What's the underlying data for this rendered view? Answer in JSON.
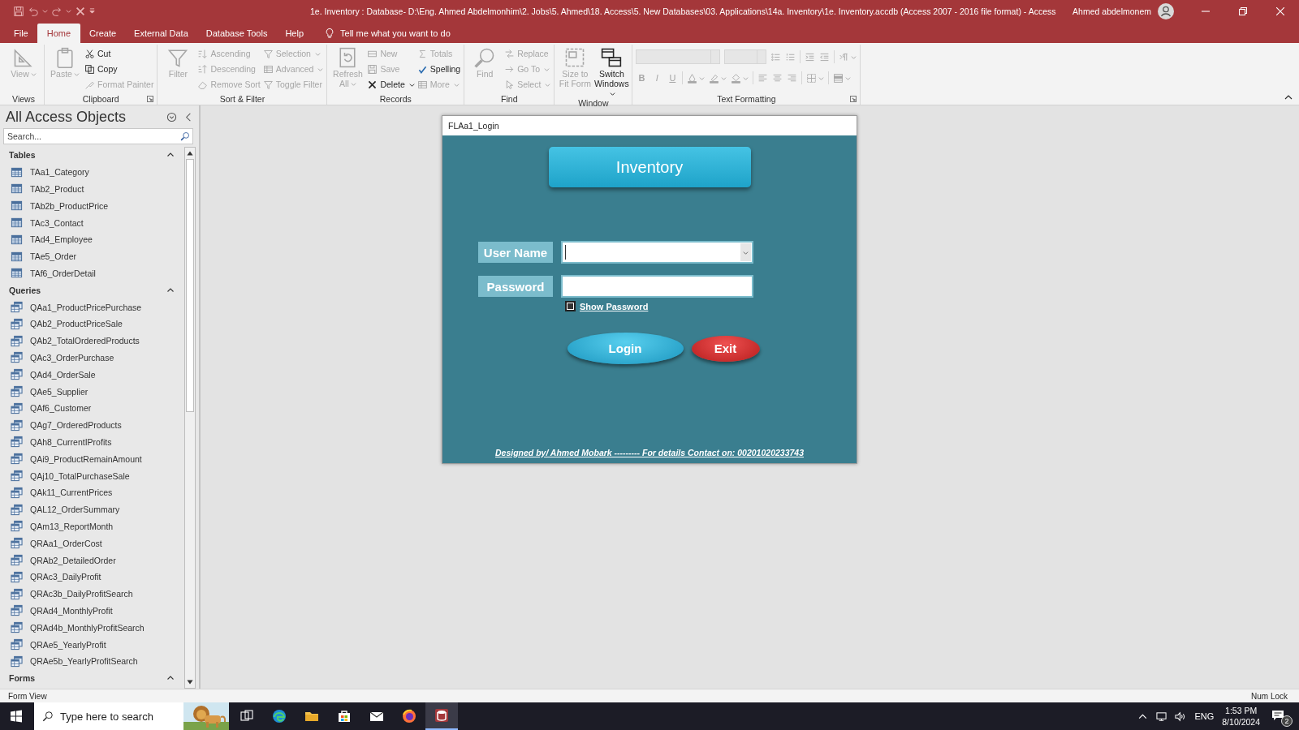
{
  "window": {
    "title": "1e. Inventory : Database- D:\\Eng. Ahmed Abdelmonhim\\2. Jobs\\5. Ahmed\\18. Access\\5. New Databases\\03. Applications\\14a. Inventory\\1e. Inventory.accdb (Access 2007 - 2016 file format)  -  Access",
    "user": "Ahmed abdelmonem"
  },
  "menu_tabs": [
    {
      "label": "File",
      "selected": false
    },
    {
      "label": "Home",
      "selected": true
    },
    {
      "label": "Create",
      "selected": false
    },
    {
      "label": "External Data",
      "selected": false
    },
    {
      "label": "Database Tools",
      "selected": false
    },
    {
      "label": "Help",
      "selected": false
    }
  ],
  "tell_me": "Tell me what you want to do",
  "ribbon": {
    "groups": [
      {
        "label": "Views",
        "expander": false,
        "columns": [
          {
            "kind": "large",
            "items": [
              {
                "label": "View",
                "disabled": true,
                "caret": true
              }
            ]
          }
        ]
      },
      {
        "label": "Clipboard",
        "expander": true,
        "columns": [
          {
            "kind": "large",
            "items": [
              {
                "label": "Paste",
                "disabled": true,
                "caret": true
              }
            ]
          },
          {
            "kind": "small",
            "items": [
              {
                "label": "Cut",
                "disabled": false,
                "caret": false
              },
              {
                "label": "Copy",
                "disabled": false,
                "caret": false
              },
              {
                "label": "Format Painter",
                "disabled": true,
                "caret": false
              }
            ]
          }
        ]
      },
      {
        "label": "Sort & Filter",
        "expander": false,
        "columns": [
          {
            "kind": "large",
            "items": [
              {
                "label": "Filter",
                "disabled": true,
                "caret": false
              }
            ]
          },
          {
            "kind": "small",
            "items": [
              {
                "label": "Ascending",
                "disabled": true,
                "caret": false
              },
              {
                "label": "Descending",
                "disabled": true,
                "caret": false
              },
              {
                "label": "Remove Sort",
                "disabled": true,
                "caret": false
              }
            ]
          },
          {
            "kind": "small",
            "items": [
              {
                "label": "Selection",
                "disabled": true,
                "caret": true
              },
              {
                "label": "Advanced",
                "disabled": true,
                "caret": true
              },
              {
                "label": "Toggle Filter",
                "disabled": true,
                "caret": false
              }
            ]
          }
        ]
      },
      {
        "label": "Records",
        "expander": false,
        "columns": [
          {
            "kind": "large",
            "items": [
              {
                "label": "Refresh All",
                "disabled": true,
                "caret": true
              }
            ]
          },
          {
            "kind": "small",
            "items": [
              {
                "label": "New",
                "disabled": true,
                "caret": false
              },
              {
                "label": "Save",
                "disabled": true,
                "caret": false
              },
              {
                "label": "Delete",
                "disabled": false,
                "caret": true
              }
            ]
          },
          {
            "kind": "small",
            "items": [
              {
                "label": "Totals",
                "disabled": true,
                "caret": false
              },
              {
                "label": "Spelling",
                "disabled": false,
                "caret": false
              },
              {
                "label": "More",
                "disabled": true,
                "caret": true
              }
            ]
          }
        ]
      },
      {
        "label": "Find",
        "expander": false,
        "columns": [
          {
            "kind": "large",
            "items": [
              {
                "label": "Find",
                "disabled": true,
                "caret": false
              }
            ]
          },
          {
            "kind": "small",
            "items": [
              {
                "label": "Replace",
                "disabled": true,
                "caret": false
              },
              {
                "label": "Go To",
                "disabled": true,
                "caret": true
              },
              {
                "label": "Select",
                "disabled": true,
                "caret": true
              }
            ]
          }
        ]
      },
      {
        "label": "Window",
        "expander": false,
        "columns": [
          {
            "kind": "large",
            "items": [
              {
                "label": "Size to Fit Form",
                "disabled": true,
                "caret": false
              }
            ]
          },
          {
            "kind": "large",
            "items": [
              {
                "label": "Switch Windows",
                "disabled": false,
                "caret": true
              }
            ]
          }
        ]
      }
    ],
    "text_formatting": {
      "label": "Text Formatting",
      "expander": true,
      "disabled": true,
      "rows": [
        [
          {
            "kind": "combo",
            "wide": true
          },
          {
            "kind": "combo",
            "wide": false
          },
          {
            "kind": "icon",
            "caret": false
          },
          {
            "kind": "icon",
            "caret": false
          },
          {
            "kind": "separator"
          },
          {
            "kind": "icon",
            "caret": false
          },
          {
            "kind": "icon",
            "caret": false
          },
          {
            "kind": "separator"
          },
          {
            "kind": "icon",
            "caret": true
          }
        ],
        [
          {
            "kind": "glyph",
            "text": "B"
          },
          {
            "kind": "glyph",
            "text": "I"
          },
          {
            "kind": "glyph",
            "text": "U"
          },
          {
            "kind": "separator"
          },
          {
            "kind": "icon",
            "caret": true
          },
          {
            "kind": "icon",
            "caret": true
          },
          {
            "kind": "icon",
            "caret": true
          },
          {
            "kind": "separator"
          },
          {
            "kind": "icon",
            "caret": false
          },
          {
            "kind": "icon",
            "caret": false
          },
          {
            "kind": "icon",
            "caret": false
          },
          {
            "kind": "separator"
          },
          {
            "kind": "icon",
            "caret": true
          },
          {
            "kind": "separator"
          },
          {
            "kind": "icon",
            "caret": true
          }
        ]
      ]
    }
  },
  "navigation": {
    "title": "All Access Objects",
    "search": {
      "placeholder": "Search..."
    },
    "groups": [
      {
        "label": "Tables",
        "kind": "table",
        "expanded": true,
        "items": [
          {
            "label": "TAa1_Category",
            "selected": false
          },
          {
            "label": "TAb2_Product",
            "selected": false
          },
          {
            "label": "TAb2b_ProductPrice",
            "selected": false
          },
          {
            "label": "TAc3_Contact",
            "selected": false
          },
          {
            "label": "TAd4_Employee",
            "selected": false
          },
          {
            "label": "TAe5_Order",
            "selected": false
          },
          {
            "label": "TAf6_OrderDetail",
            "selected": false
          }
        ]
      },
      {
        "label": "Queries",
        "kind": "query",
        "expanded": true,
        "items": [
          {
            "label": "QAa1_ProductPricePurchase",
            "selected": false
          },
          {
            "label": "QAb2_ProductPriceSale",
            "selected": false
          },
          {
            "label": "QAb2_TotalOrderedProducts",
            "selected": false
          },
          {
            "label": "QAc3_OrderPurchase",
            "selected": false
          },
          {
            "label": "QAd4_OrderSale",
            "selected": false
          },
          {
            "label": "QAe5_Supplier",
            "selected": false
          },
          {
            "label": "QAf6_Customer",
            "selected": false
          },
          {
            "label": "QAg7_OrderedProducts",
            "selected": false
          },
          {
            "label": "QAh8_CurrentIProfits",
            "selected": false
          },
          {
            "label": "QAi9_ProductRemainAmount",
            "selected": false
          },
          {
            "label": "QAj10_TotalPurchaseSale",
            "selected": false
          },
          {
            "label": "QAk11_CurrentPrices",
            "selected": false
          },
          {
            "label": "QAL12_OrderSummary",
            "selected": false
          },
          {
            "label": "QAm13_ReportMonth",
            "selected": false
          },
          {
            "label": "QRAa1_OrderCost",
            "selected": false
          },
          {
            "label": "QRAb2_DetailedOrder",
            "selected": false
          },
          {
            "label": "QRAc3_DailyProfit",
            "selected": false
          },
          {
            "label": "QRAc3b_DailyProfitSearch",
            "selected": false
          },
          {
            "label": "QRAd4_MonthlyProfit",
            "selected": false
          },
          {
            "label": "QRAd4b_MonthlyProfitSearch",
            "selected": false
          },
          {
            "label": "QRAe5_YearlyProfit",
            "selected": false
          },
          {
            "label": "QRAe5b_YearlyProfitSearch",
            "selected": false
          }
        ]
      },
      {
        "label": "Forms",
        "expanded": true
      }
    ]
  },
  "form": {
    "title": "FLAa1_Login",
    "heading": "Inventory",
    "fields": [
      {
        "label": "User Name",
        "kind": "combo"
      },
      {
        "label": "Password",
        "kind": "text"
      }
    ],
    "show_password": {
      "label": "Show Password",
      "checked": false
    },
    "buttons": [
      {
        "label": "Login",
        "kind": "primary"
      },
      {
        "label": "Exit",
        "kind": "danger"
      }
    ],
    "footer": "Designed by/ Ahmed Mobark --------- For details Contact on: 00201020233743"
  },
  "status_bar": {
    "view": "Form View",
    "keys": "Num Lock"
  },
  "taskbar": {
    "search": {
      "placeholder": "Type here to search"
    },
    "apps": [
      {
        "kind": "task-view",
        "active": false
      },
      {
        "kind": "edge",
        "active": false
      },
      {
        "kind": "folder",
        "active": false
      },
      {
        "kind": "store",
        "active": false
      },
      {
        "kind": "mail",
        "active": false
      },
      {
        "kind": "firefox",
        "active": false
      },
      {
        "kind": "access",
        "active": true
      }
    ],
    "language": "ENG",
    "time": "1:53 PM",
    "date": "8/10/2024",
    "notifications": "2"
  }
}
